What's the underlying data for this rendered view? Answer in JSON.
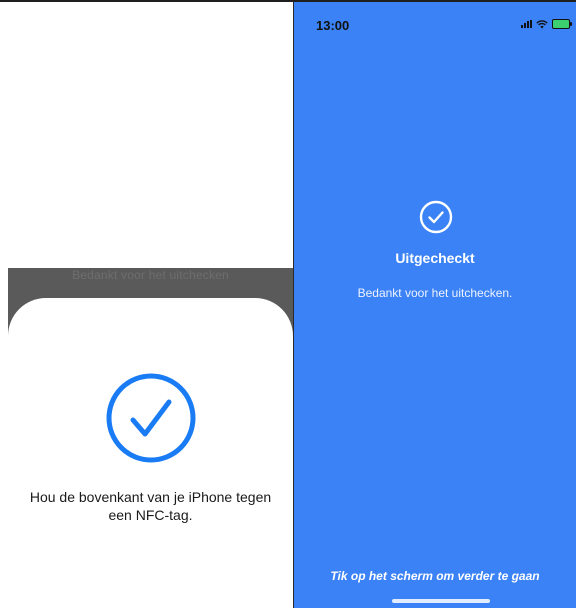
{
  "left": {
    "background_caption": "Bedankt voor het uitchecken",
    "nfc_sheet": {
      "icon": "checkmark-circle-icon",
      "message": "Hou de bovenkant van je iPhone tegen een NFC-tag.",
      "accent_color": "#1a7cf5"
    }
  },
  "right": {
    "status_bar": {
      "time": "13:00",
      "icons": [
        "signal-icon",
        "wifi-icon",
        "battery-icon"
      ]
    },
    "icon": "checkmark-circle-icon",
    "title": "Uitgecheckt",
    "subtitle": "Bedankt voor het uitchecken.",
    "tap_hint": "Tik op het scherm om verder te gaan",
    "background_color": "#3b82f6"
  }
}
